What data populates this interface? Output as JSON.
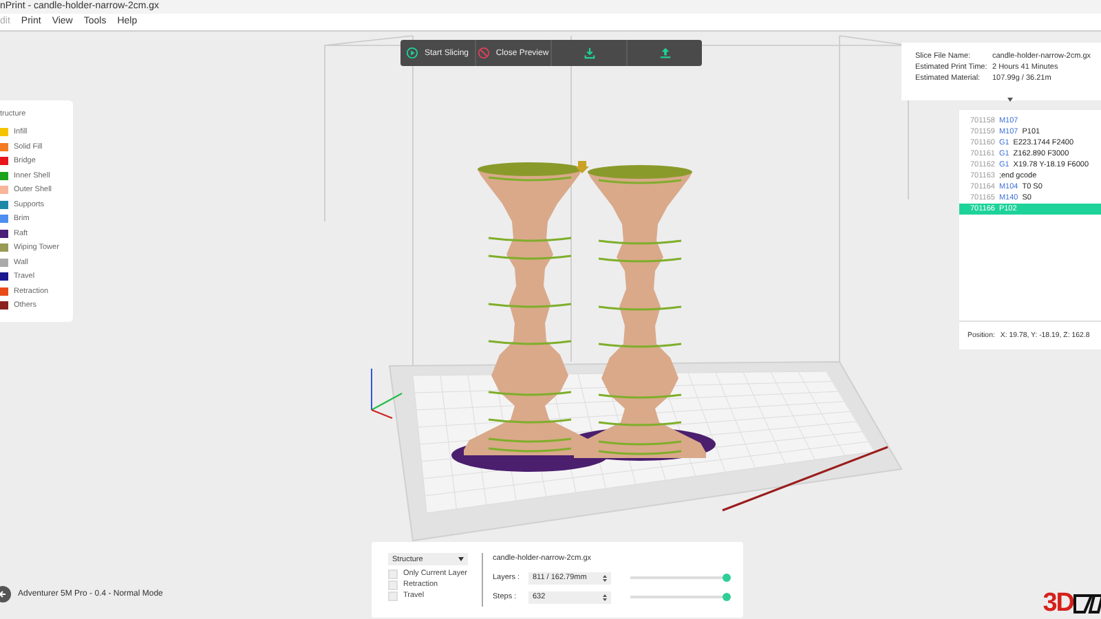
{
  "window": {
    "title": "nPrint - candle-holder-narrow-2cm.gx"
  },
  "menu": [
    "dit",
    "Print",
    "View",
    "Tools",
    "Help"
  ],
  "toolbar": [
    {
      "kind": "slice",
      "label": "Start Slicing"
    },
    {
      "kind": "close",
      "label": "Close Preview"
    },
    {
      "kind": "download"
    },
    {
      "kind": "send"
    }
  ],
  "legend": {
    "title": "tructure",
    "items": [
      {
        "label": "Infill",
        "color": "#f5c400"
      },
      {
        "label": "Solid Fill",
        "color": "#f47b20"
      },
      {
        "label": "Bridge",
        "color": "#e8151b"
      },
      {
        "label": "Inner Shell",
        "color": "#1aa31a"
      },
      {
        "label": "Outer Shell",
        "color": "#f7b69a"
      },
      {
        "label": "Supports",
        "color": "#1e88a8"
      },
      {
        "label": "Brim",
        "color": "#4d8ef0"
      },
      {
        "label": "Raft",
        "color": "#4b1e7a"
      },
      {
        "label": "Wiping Tower",
        "color": "#999a55"
      },
      {
        "label": "Wall",
        "color": "#aaaaaa"
      },
      {
        "label": "Travel",
        "color": "#1c1890"
      },
      {
        "label": "Retraction",
        "color": "#e84a1a"
      },
      {
        "label": "Others",
        "color": "#8b2020"
      }
    ]
  },
  "slice_info": [
    {
      "label": "Slice File Name:",
      "value": "candle-holder-narrow-2cm.gx"
    },
    {
      "label": "Estimated Print Time:",
      "value": "2 Hours 41 Minutes"
    },
    {
      "label": "Estimated Material:",
      "value": "107.99g / 36.21m"
    }
  ],
  "gcode": {
    "lines": [
      {
        "number": "701158",
        "command": "M107",
        "selected": false
      },
      {
        "number": "701159",
        "command": "M107",
        "args": "P101",
        "selected": false
      },
      {
        "number": "701160",
        "command": "G1",
        "args": "E223.1744 F2400",
        "selected": false
      },
      {
        "number": "701161",
        "command": "G1",
        "args": "Z162.890 F3000",
        "selected": false
      },
      {
        "number": "701162",
        "command": "G1",
        "args": "X19.78 Y-18.19 F6000",
        "selected": false
      },
      {
        "number": "701163",
        "args": ";end gcode",
        "selected": false
      },
      {
        "number": "701164",
        "command": "M104",
        "args": "T0 S0",
        "selected": false
      },
      {
        "number": "701165",
        "command": "M140",
        "args": "S0",
        "selected": false
      },
      {
        "number": "701166",
        "args": "P102",
        "selected": true
      }
    ],
    "position_label": "Position:",
    "position": "X: 19.78, Y: -18.19, Z: 162.8"
  },
  "preview": {
    "mode": "Structure",
    "options": [
      {
        "label": "Only Current Layer",
        "checked": false
      },
      {
        "label": "Retraction",
        "checked": false
      },
      {
        "label": "Travel",
        "checked": false
      }
    ],
    "file_name": "candle-holder-narrow-2cm.gx",
    "layers": {
      "label": "Layers :",
      "value": "811 / 162.79mm",
      "level": 1
    },
    "steps": {
      "label": "Steps :",
      "value": "632",
      "level": 1
    }
  },
  "status_bar": {
    "printer": "Adventurer 5M Pro - 0.4 - Normal Mode"
  },
  "logo_text": "3D"
}
